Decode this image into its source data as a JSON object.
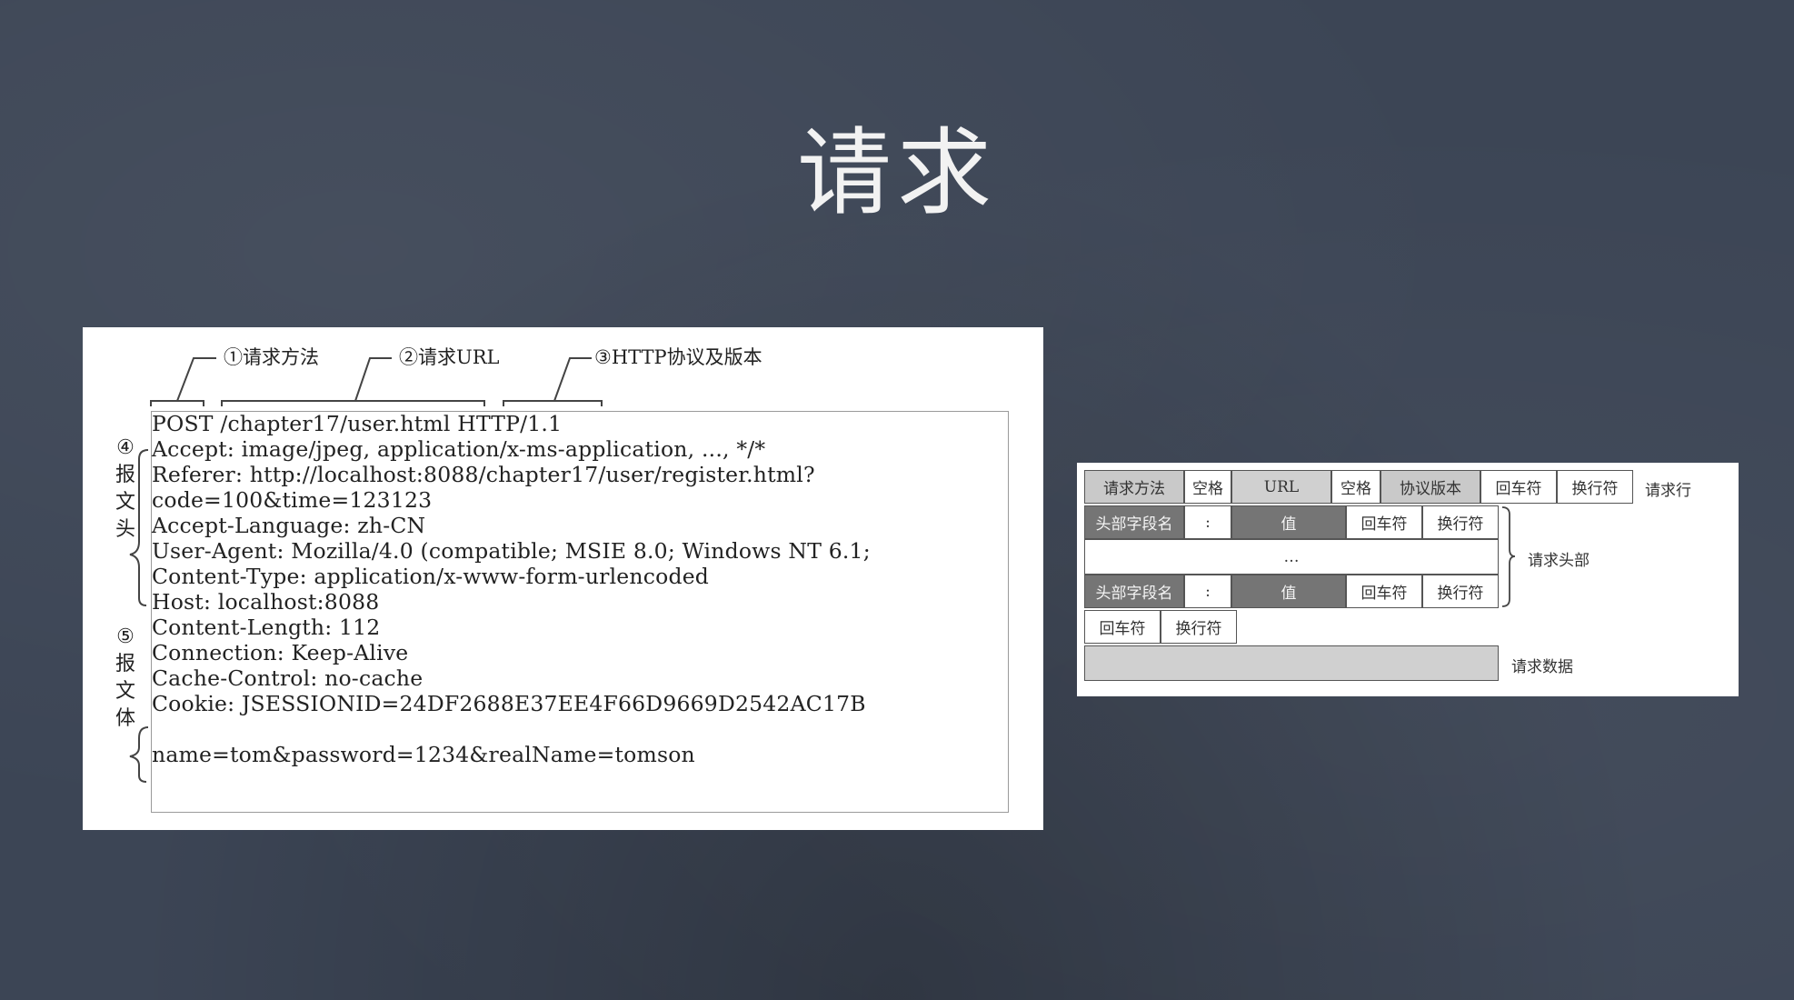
{
  "slide": {
    "title": "请求"
  },
  "http_example": {
    "callouts": {
      "method": "①请求方法",
      "url": "②请求URL",
      "version": "③HTTP协议及版本"
    },
    "side_labels": {
      "header_num": "④",
      "header_chars": [
        "报",
        "文",
        "头"
      ],
      "body_num": "⑤",
      "body_chars": [
        "报",
        "文",
        "体"
      ]
    },
    "lines": [
      "POST /chapter17/user.html HTTP/1.1",
      "Accept: image/jpeg, application/x-ms-application, ..., */*",
      "Referer: http://localhost:8088/chapter17/user/register.html?",
      "code=100&time=123123",
      "Accept-Language: zh-CN",
      "User-Agent: Mozilla/4.0 (compatible; MSIE 8.0; Windows NT 6.1;",
      "Content-Type: application/x-www-form-urlencoded",
      "Host: localhost:8088",
      "Content-Length: 112",
      "Connection: Keep-Alive",
      "Cache-Control: no-cache",
      "Cookie: JSESSIONID=24DF2688E37EE4F66D9669D2542AC17B",
      "",
      "name=tom&password=1234&realName=tomson"
    ]
  },
  "request_format": {
    "row1": [
      "请求方法",
      "空格",
      "URL",
      "空格",
      "协议版本",
      "回车符",
      "换行符"
    ],
    "row1_label": "请求行",
    "header_row": [
      "头部字段名",
      ":",
      "值",
      "回车符",
      "换行符"
    ],
    "ellipsis": "…",
    "header_label": "请求头部",
    "crlf_row": [
      "回车符",
      "换行符"
    ],
    "data_label": "请求数据"
  }
}
